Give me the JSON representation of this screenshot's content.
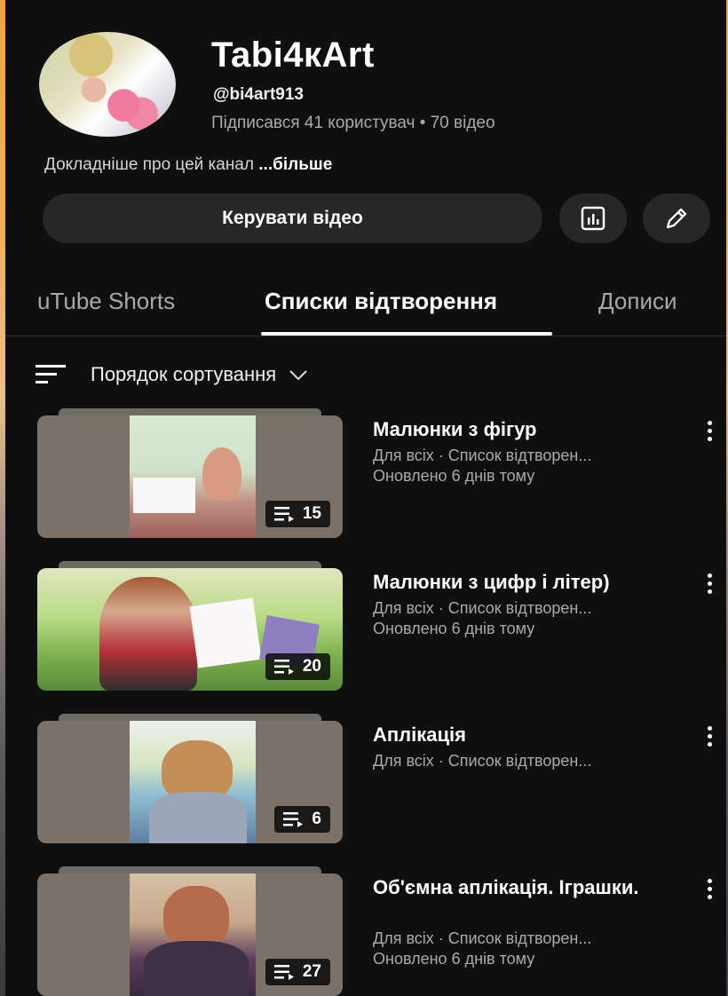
{
  "channel": {
    "name": "Tabi4кArt",
    "handle": "@bi4art913",
    "stats": "Підписався 41 користувач • 70 відео",
    "about_text": "Докладніше про цей канал ",
    "about_more": "...більше"
  },
  "actions": {
    "manage_videos_label": "Керувати відео",
    "analytics_icon": "analytics-icon",
    "edit_icon": "pencil-icon"
  },
  "tabs": [
    {
      "label": "uTube Shorts",
      "active": false
    },
    {
      "label": "Списки відтворення",
      "active": true
    },
    {
      "label": "Дописи",
      "active": false
    }
  ],
  "sort": {
    "label": "Порядок сортування",
    "icon": "sort-icon",
    "chevron": "chevron-down-icon"
  },
  "playlists": [
    {
      "title": "Малюнки з фігур",
      "line1": "Для всіх · Список відтворен...",
      "line2": "Оновлено 6 днів тому",
      "count": "15"
    },
    {
      "title": "Малюнки з цифр і літер)",
      "line1": "Для всіх · Список відтворен...",
      "line2": "Оновлено 6 днів тому",
      "count": "20"
    },
    {
      "title": "Аплікація",
      "line1": "Для всіх · Список відтворен...",
      "line2": "",
      "count": "6"
    },
    {
      "title": "Об'ємна аплікація. Іграшки.",
      "line1": "Для всіх · Список відтворен...",
      "line2": "Оновлено 6 днів тому",
      "count": "27"
    }
  ],
  "colors": {
    "background": "#0f0f0f",
    "button_bg": "#272727",
    "secondary_text": "#aaaaaa",
    "backdrop_accent": "#f3a441"
  }
}
